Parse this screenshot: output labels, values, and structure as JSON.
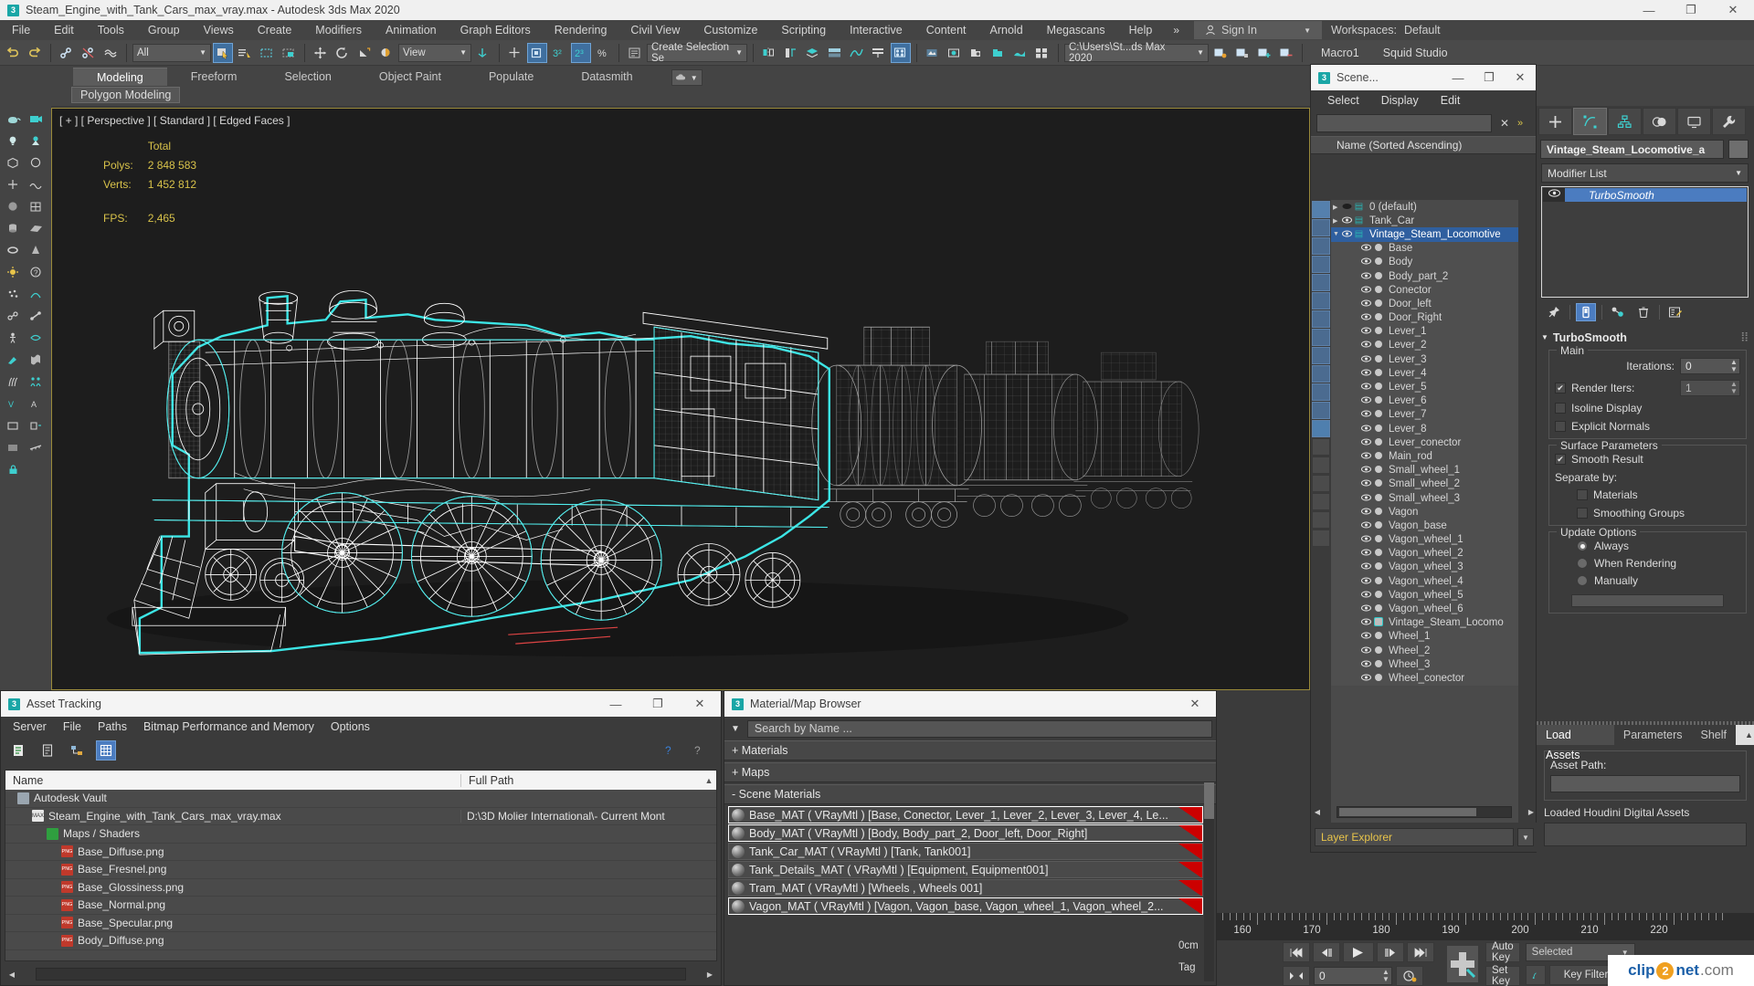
{
  "titlebar": {
    "app_icon": "3dsmax-logo-icon",
    "title": "Steam_Engine_with_Tank_Cars_max_vray.max - Autodesk 3ds Max 2020",
    "minimize": "—",
    "maximize": "❐",
    "close": "✕"
  },
  "menubar": {
    "items": [
      "File",
      "Edit",
      "Tools",
      "Group",
      "Views",
      "Create",
      "Modifiers",
      "Animation",
      "Graph Editors",
      "Rendering",
      "Civil View",
      "Customize",
      "Scripting",
      "Interactive",
      "Content",
      "Arnold",
      "Megascans",
      "Help"
    ],
    "overflow": "»",
    "signin": "Sign In",
    "workspaces_label": "Workspaces:",
    "workspaces_value": "Default"
  },
  "toolbar": {
    "selection_filter": "All",
    "ref_coord": "View",
    "selection_set": "Create Selection Se",
    "project_path": "C:\\Users\\St...ds Max 2020",
    "macro": "Macro1",
    "studio": "Squid Studio"
  },
  "ribbon": {
    "tabs": [
      "Modeling",
      "Freeform",
      "Selection",
      "Object Paint",
      "Populate",
      "Datasmith"
    ],
    "active_tab": "Modeling",
    "subtab": "Polygon Modeling"
  },
  "viewport": {
    "label": "[ + ] [ Perspective ] [ Standard ] [ Edged Faces ]",
    "stats": {
      "total_header": "Total",
      "polys_label": "Polys:",
      "polys_value": "2 848 583",
      "verts_label": "Verts:",
      "verts_value": "1 452 812",
      "fps_label": "FPS:",
      "fps_value": "2,465"
    }
  },
  "scene_explorer": {
    "window_title": "Scene...",
    "menu": [
      "Select",
      "Display",
      "Edit"
    ],
    "search_value": "",
    "clear_icon": "✕",
    "overflow": "»",
    "column_header": "Name (Sorted Ascending)",
    "footer_label": "Layer Explorer",
    "rows": [
      {
        "name": "0 (default)",
        "depth": 0,
        "type": "layer",
        "expander": "▶",
        "visible": false,
        "selected": false
      },
      {
        "name": "Tank_Car",
        "depth": 0,
        "type": "layer",
        "expander": "▶",
        "visible": true,
        "selected": false
      },
      {
        "name": "Vintage_Steam_Locomotive",
        "depth": 0,
        "type": "layer",
        "expander": "▼",
        "visible": true,
        "selected": true
      },
      {
        "name": "Base",
        "depth": 1,
        "type": "object",
        "visible": true,
        "selected": false
      },
      {
        "name": "Body",
        "depth": 1,
        "type": "object",
        "visible": true,
        "selected": false
      },
      {
        "name": "Body_part_2",
        "depth": 1,
        "type": "object",
        "visible": true,
        "selected": false
      },
      {
        "name": "Conector",
        "depth": 1,
        "type": "object",
        "visible": true,
        "selected": false
      },
      {
        "name": "Door_left",
        "depth": 1,
        "type": "object",
        "visible": true,
        "selected": false
      },
      {
        "name": "Door_Right",
        "depth": 1,
        "type": "object",
        "visible": true,
        "selected": false
      },
      {
        "name": "Lever_1",
        "depth": 1,
        "type": "object",
        "visible": true,
        "selected": false
      },
      {
        "name": "Lever_2",
        "depth": 1,
        "type": "object",
        "visible": true,
        "selected": false
      },
      {
        "name": "Lever_3",
        "depth": 1,
        "type": "object",
        "visible": true,
        "selected": false
      },
      {
        "name": "Lever_4",
        "depth": 1,
        "type": "object",
        "visible": true,
        "selected": false
      },
      {
        "name": "Lever_5",
        "depth": 1,
        "type": "object",
        "visible": true,
        "selected": false
      },
      {
        "name": "Lever_6",
        "depth": 1,
        "type": "object",
        "visible": true,
        "selected": false
      },
      {
        "name": "Lever_7",
        "depth": 1,
        "type": "object",
        "visible": true,
        "selected": false
      },
      {
        "name": "Lever_8",
        "depth": 1,
        "type": "object",
        "visible": true,
        "selected": false
      },
      {
        "name": "Lever_conector",
        "depth": 1,
        "type": "object",
        "visible": true,
        "selected": false
      },
      {
        "name": "Main_rod",
        "depth": 1,
        "type": "object",
        "visible": true,
        "selected": false
      },
      {
        "name": "Small_wheel_1",
        "depth": 1,
        "type": "object",
        "visible": true,
        "selected": false
      },
      {
        "name": "Small_wheel_2",
        "depth": 1,
        "type": "object",
        "visible": true,
        "selected": false
      },
      {
        "name": "Small_wheel_3",
        "depth": 1,
        "type": "object",
        "visible": true,
        "selected": false
      },
      {
        "name": "Vagon",
        "depth": 1,
        "type": "object",
        "visible": true,
        "selected": false
      },
      {
        "name": "Vagon_base",
        "depth": 1,
        "type": "object",
        "visible": true,
        "selected": false
      },
      {
        "name": "Vagon_wheel_1",
        "depth": 1,
        "type": "object",
        "visible": true,
        "selected": false
      },
      {
        "name": "Vagon_wheel_2",
        "depth": 1,
        "type": "object",
        "visible": true,
        "selected": false
      },
      {
        "name": "Vagon_wheel_3",
        "depth": 1,
        "type": "object",
        "visible": true,
        "selected": false
      },
      {
        "name": "Vagon_wheel_4",
        "depth": 1,
        "type": "object",
        "visible": true,
        "selected": false
      },
      {
        "name": "Vagon_wheel_5",
        "depth": 1,
        "type": "object",
        "visible": true,
        "selected": false
      },
      {
        "name": "Vagon_wheel_6",
        "depth": 1,
        "type": "object",
        "visible": true,
        "selected": false
      },
      {
        "name": "Vintage_Steam_Locomo",
        "depth": 1,
        "type": "group",
        "visible": true,
        "selected": false
      },
      {
        "name": "Wheel_1",
        "depth": 1,
        "type": "object",
        "visible": true,
        "selected": false
      },
      {
        "name": "Wheel_2",
        "depth": 1,
        "type": "object",
        "visible": true,
        "selected": false
      },
      {
        "name": "Wheel_3",
        "depth": 1,
        "type": "object",
        "visible": true,
        "selected": false
      },
      {
        "name": "Wheel_conector",
        "depth": 1,
        "type": "object",
        "visible": true,
        "selected": false
      }
    ]
  },
  "command_panel": {
    "tabs": [
      "create-icon",
      "modify-icon",
      "hierarchy-icon",
      "motion-icon",
      "display-icon",
      "utilities-icon"
    ],
    "active_tab_index": 1,
    "object_name": "Vintage_Steam_Locomotive_a",
    "modifier_list_label": "Modifier List",
    "stack": [
      {
        "name": "TurboSmooth",
        "selected": true
      }
    ],
    "rollup": {
      "title": "TurboSmooth",
      "main_group": "Main",
      "iterations_label": "Iterations:",
      "iterations_value": "0",
      "render_iters_label": "Render Iters:",
      "render_iters_value": "1",
      "render_iters_checked": true,
      "isoline_label": "Isoline Display",
      "isoline_checked": false,
      "explicit_label": "Explicit Normals",
      "explicit_checked": false,
      "surface_group": "Surface Parameters",
      "smooth_result_label": "Smooth Result",
      "smooth_result_checked": true,
      "separate_by_label": "Separate by:",
      "materials_label": "Materials",
      "materials_checked": false,
      "smoothing_groups_label": "Smoothing Groups",
      "smoothing_groups_checked": false,
      "update_group": "Update Options",
      "update_options": [
        "Always",
        "When Rendering",
        "Manually"
      ],
      "update_selected": "Always"
    }
  },
  "houdini_panel": {
    "tabs": [
      "Load Assets",
      "Parameters",
      "Shelf"
    ],
    "active_tab": "Load Assets",
    "asset_path_label": "Asset Path:",
    "asset_path_value": "",
    "loaded_label": "Loaded Houdini Digital Assets"
  },
  "asset_tracking": {
    "window_title": "Asset Tracking",
    "menu": [
      "Server",
      "File",
      "Paths",
      "Bitmap Performance and Memory",
      "Options"
    ],
    "columns": [
      "Name",
      "Full Path"
    ],
    "rows": [
      {
        "name": "Autodesk Vault",
        "path": "",
        "depth": 0,
        "icon": "vault-icon"
      },
      {
        "name": "Steam_Engine_with_Tank_Cars_max_vray.max",
        "path": "D:\\3D Molier International\\- Current Mont",
        "depth": 1,
        "icon": "max-file-icon"
      },
      {
        "name": "Maps / Shaders",
        "path": "",
        "depth": 2,
        "icon": "maps-icon"
      },
      {
        "name": "Base_Diffuse.png",
        "path": "",
        "depth": 3,
        "icon": "png-icon"
      },
      {
        "name": "Base_Fresnel.png",
        "path": "",
        "depth": 3,
        "icon": "png-icon"
      },
      {
        "name": "Base_Glossiness.png",
        "path": "",
        "depth": 3,
        "icon": "png-icon"
      },
      {
        "name": "Base_Normal.png",
        "path": "",
        "depth": 3,
        "icon": "png-icon"
      },
      {
        "name": "Base_Specular.png",
        "path": "",
        "depth": 3,
        "icon": "png-icon"
      },
      {
        "name": "Body_Diffuse.png",
        "path": "",
        "depth": 3,
        "icon": "png-icon"
      }
    ]
  },
  "material_browser": {
    "window_title": "Material/Map Browser",
    "search_placeholder": "Search by Name ...",
    "groups": [
      "+ Materials",
      "+ Maps",
      "- Scene Materials"
    ],
    "materials": [
      {
        "label": "Base_MAT ( VRayMtl ) [Base, Conector, Lever_1, Lever_2, Lever_3, Lever_4, Le...",
        "highlight": true
      },
      {
        "label": "Body_MAT ( VRayMtl ) [Body, Body_part_2, Door_left, Door_Right]",
        "highlight": true
      },
      {
        "label": "Tank_Car_MAT ( VRayMtl ) [Tank, Tank001]",
        "highlight": false
      },
      {
        "label": "Tank_Details_MAT ( VRayMtl ) [Equipment, Equipment001]",
        "highlight": false
      },
      {
        "label": "Tram_MAT ( VRayMtl ) [Wheels , Wheels 001]",
        "highlight": false
      },
      {
        "label": "Vagon_MAT ( VRayMtl ) [Vagon, Vagon_base, Vagon_wheel_1, Vagon_wheel_2...",
        "highlight": true
      }
    ]
  },
  "timeline": {
    "ticks": [
      "160",
      "170",
      "180",
      "190",
      "200",
      "210",
      "220"
    ],
    "units": "0cm",
    "tag_label": "Tag",
    "frame_value": "0",
    "auto_key": "Auto Key",
    "set_key": "Set Key",
    "key_mode": "Selected",
    "key_filters": "Key Filters...",
    "nav_icons": [
      "first-frame-icon",
      "prev-frame-icon",
      "play-icon",
      "next-frame-icon",
      "last-frame-icon"
    ]
  },
  "watermark": {
    "text_1": "clip",
    "text_2": "2",
    "text_3": "net",
    "text_4": ".com"
  },
  "colors": {
    "accent_blue": "#2f5f9f",
    "highlight_teal": "#29b3b3",
    "stat_yellow": "#d8c24a",
    "wire_cyan": "#3ef0f0",
    "red_corner": "#cc0000"
  }
}
